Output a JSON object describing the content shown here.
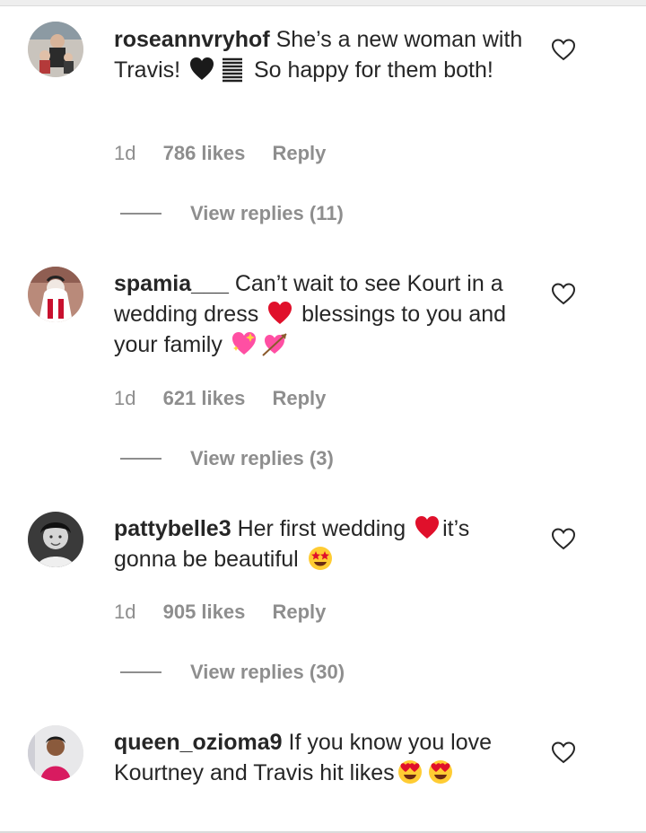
{
  "comments": [
    {
      "username": "roseannvryhof",
      "text_parts": [
        "She’s a new woman with Travis! ",
        " So happy for them both!"
      ],
      "emojis": [
        "black-heart",
        "memo"
      ],
      "time": "1d",
      "likes": "786 likes",
      "reply": "Reply",
      "view_replies": "View replies (11)"
    },
    {
      "username": "spamia___",
      "text_parts": [
        "Can’t wait to see Kourt in a wedding dress ",
        " blessings to you and your family "
      ],
      "emojis": [
        "red-heart",
        "sparkling-heart",
        "heart-with-arrow"
      ],
      "time": "1d",
      "likes": "621 likes",
      "reply": "Reply",
      "view_replies": "View replies (3)"
    },
    {
      "username": "pattybelle3",
      "text_parts": [
        "Her first wedding ",
        "it’s gonna be beautiful "
      ],
      "emojis": [
        "red-heart",
        "star-struck"
      ],
      "time": "1d",
      "likes": "905 likes",
      "reply": "Reply",
      "view_replies": "View replies (30)"
    },
    {
      "username": "queen_ozioma9",
      "text_parts": [
        "If you know you love Kourtney and Travis hit likes"
      ],
      "emojis": [
        "heart-eyes",
        "heart-eyes"
      ]
    }
  ],
  "colors": {
    "text": "#262626",
    "secondary": "#8e8e8e",
    "red_heart": "#e0102b",
    "pink_heart": "#ff4fa3"
  }
}
